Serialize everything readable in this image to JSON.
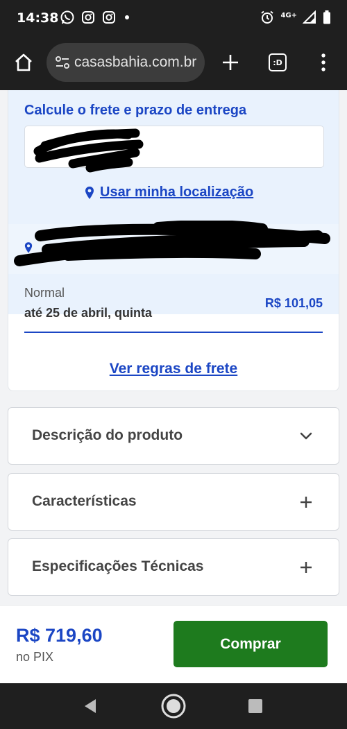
{
  "status_bar": {
    "time": "14:38",
    "network": "4G+",
    "notification_icons": [
      "whatsapp-icon",
      "instagram-icon",
      "instagram-icon",
      "dot-icon"
    ],
    "system_icons": [
      "alarm-icon",
      "signal-icon",
      "battery-icon"
    ]
  },
  "browser": {
    "url": "casasbahia.com.br",
    "tab_count_label": ":D",
    "icons": [
      "home-icon",
      "site-settings-icon",
      "new-tab-icon",
      "tab-switcher-icon",
      "menu-dots-icon"
    ]
  },
  "freight": {
    "title": "Calcule o frete e prazo de entrega",
    "cep_placeholder": "",
    "use_location_label": "Usar minha localização",
    "shipping": {
      "type": "Normal",
      "date": "até 25 de abril, quinta",
      "price": "R$ 101,05"
    },
    "rules_link": "Ver regras de frete"
  },
  "accordions": [
    {
      "title": "Descrição do produto",
      "icon": "chevron-down-icon"
    },
    {
      "title": "Características",
      "icon": "plus-icon"
    },
    {
      "title": "Especificações Técnicas",
      "icon": "plus-icon"
    }
  ],
  "buy_bar": {
    "price": "R$ 719,60",
    "method": "no PIX",
    "button_label": "Comprar"
  },
  "colors": {
    "brand_blue": "#1b46c4",
    "buy_green": "#1e7b1e",
    "freight_background": "#e9f2fd",
    "system_bar": "#1f1f1f"
  }
}
